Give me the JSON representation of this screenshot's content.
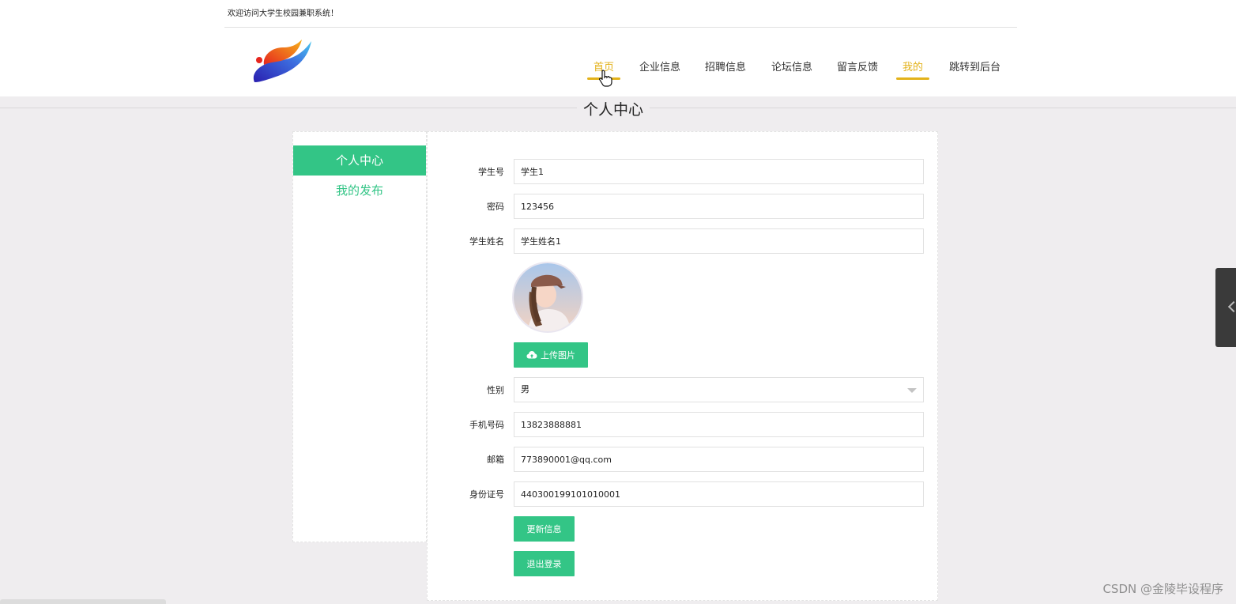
{
  "header": {
    "welcome_text": "欢迎访问大学生校园兼职系统！",
    "logo_icon": "flame-swoosh-logo"
  },
  "nav": {
    "items": [
      {
        "label": "首页",
        "active": true
      },
      {
        "label": "企业信息",
        "active": false
      },
      {
        "label": "招聘信息",
        "active": false
      },
      {
        "label": "论坛信息",
        "active": false
      },
      {
        "label": "留言反馈",
        "active": false
      },
      {
        "label": "我的",
        "active": true
      },
      {
        "label": "跳转到后台",
        "active": false
      }
    ],
    "accent_color": "#e3b21a"
  },
  "page": {
    "title": "个人中心"
  },
  "sidebar": {
    "items": [
      {
        "label": "个人中心",
        "active": true
      },
      {
        "label": "我的发布",
        "active": false
      }
    ],
    "accent_color": "#33c586"
  },
  "form": {
    "student_no": {
      "label": "学生号",
      "value": "学生1"
    },
    "password": {
      "label": "密码",
      "value": "123456"
    },
    "student_name": {
      "label": "学生姓名",
      "value": "学生姓名1"
    },
    "upload_label": "上传图片",
    "gender": {
      "label": "性别",
      "value": "男"
    },
    "phone": {
      "label": "手机号码",
      "value": "13823888881"
    },
    "email": {
      "label": "邮箱",
      "value": "773890001@qq.com"
    },
    "id_card": {
      "label": "身份证号",
      "value": "440300199101010001"
    },
    "update_label": "更新信息",
    "logout_label": "退出登录"
  },
  "watermark": "CSDN @金陵毕设程序"
}
